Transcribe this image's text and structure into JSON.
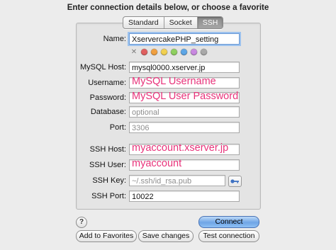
{
  "header": {
    "title": "Enter connection details below, or choose a favorite"
  },
  "tabs": [
    {
      "label": "Standard",
      "selected": false
    },
    {
      "label": "Socket",
      "selected": false
    },
    {
      "label": "SSH",
      "selected": true
    }
  ],
  "form": {
    "name": {
      "label": "Name:",
      "value": "XservercakePHP_setting"
    },
    "favorite_colors": {
      "clear_glyph": "✕",
      "swatches": [
        "#e06060",
        "#f0a040",
        "#f1d050",
        "#8fd060",
        "#5da6e6",
        "#c888e0",
        "#a9a9a9"
      ]
    },
    "mysql_host": {
      "label": "MySQL Host:",
      "value": "mysql0000.xserver.jp"
    },
    "username": {
      "label": "Username:",
      "value": "",
      "overlay": "MySQL Username"
    },
    "password": {
      "label": "Password:",
      "value": "",
      "overlay": "MySQL User Password"
    },
    "database": {
      "label": "Database:",
      "placeholder": "optional"
    },
    "port": {
      "label": "Port:",
      "placeholder": "3306"
    },
    "ssh_host": {
      "label": "SSH Host:",
      "value": "",
      "overlay": "myaccount.xserver.jp"
    },
    "ssh_user": {
      "label": "SSH User:",
      "value": "",
      "overlay": "myaccount"
    },
    "ssh_key": {
      "label": "SSH Key:",
      "placeholder": "~/.ssh/id_rsa.pub"
    },
    "ssh_port": {
      "label": "SSH Port:",
      "value": "10022"
    }
  },
  "buttons": {
    "help": "?",
    "connect": "Connect",
    "add_to_favorites": "Add to Favorites",
    "save_changes": "Save changes",
    "test_connection": "Test connection"
  },
  "colors": {
    "overlay_pink": "#e8327a",
    "focus_ring": "#9cc2ee",
    "default_button": "#6fa5e6"
  }
}
